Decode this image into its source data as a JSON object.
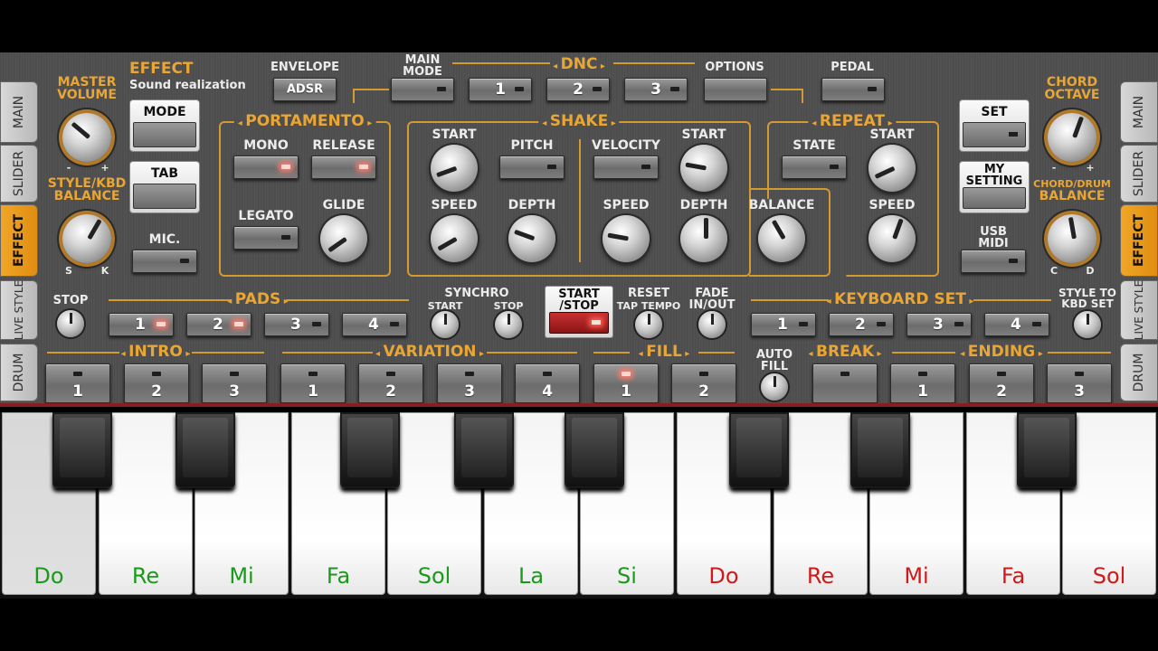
{
  "left_tabs": [
    "MAIN",
    "SLIDER",
    "EFFECT",
    "LIVE STYLE",
    "DRUM"
  ],
  "right_tabs": [
    "MAIN",
    "SLIDER",
    "EFFECT",
    "LIVE STYLE",
    "DRUM"
  ],
  "active_tab": "EFFECT",
  "top": {
    "master_volume": "MASTER\nVOLUME",
    "effect_title": "EFFECT",
    "effect_sub": "Sound realization",
    "envelope": "ENVELOPE",
    "adsr": "ADSR",
    "main_mode": "MAIN\nMODE",
    "dnc": "DNC",
    "dnc_buttons": [
      "1",
      "2",
      "3"
    ],
    "options": "OPTIONS",
    "pedal": "PEDAL",
    "chord_octave": "CHORD\nOCTAVE",
    "plus_minus": [
      "-",
      "+"
    ]
  },
  "left_col": {
    "mode": "MODE",
    "tab": "TAB",
    "style_kbd_balance": "STYLE/KBD\nBALANCE",
    "mic": "MIC.",
    "s": "S",
    "k": "K"
  },
  "portamento": {
    "title": "PORTAMENTO",
    "mono": "MONO",
    "release": "RELEASE",
    "legato": "LEGATO",
    "glide": "GLIDE"
  },
  "shake": {
    "title": "SHAKE",
    "start": "START",
    "pitch": "PITCH",
    "speed": "SPEED",
    "depth": "DEPTH",
    "velocity": "VELOCITY",
    "start2": "START",
    "speed2": "SPEED",
    "depth2": "DEPTH",
    "balance": "BALANCE"
  },
  "repeat": {
    "title": "REPEAT",
    "state": "STATE",
    "start": "START",
    "speed": "SPEED"
  },
  "right_col": {
    "set": "SET",
    "my_setting": "MY\nSETTING",
    "usb_midi": "USB\nMIDI",
    "chord_drum_balance_top": "CHORD/DRUM",
    "chord_drum_balance": "BALANCE",
    "c": "C",
    "d": "D"
  },
  "row3": {
    "stop": "STOP",
    "pads": "PADS",
    "pad_buttons": [
      "1",
      "2",
      "3",
      "4"
    ],
    "synchro": "SYNCHRO",
    "synchro_start": "START",
    "synchro_stop": "STOP",
    "start_stop": "START\n/STOP",
    "reset": "RESET",
    "tap_tempo": "TAP TEMPO",
    "fade": "FADE\nIN/OUT",
    "keyboard_set": "KEYBOARD SET",
    "kbd_buttons": [
      "1",
      "2",
      "3",
      "4"
    ],
    "style_to_kbd": "STYLE TO\nKBD SET"
  },
  "row4": {
    "intro": "INTRO",
    "intro_buttons": [
      "1",
      "2",
      "3"
    ],
    "variation": "VARIATION",
    "variation_buttons": [
      "1",
      "2",
      "3",
      "4"
    ],
    "fill": "FILL",
    "fill_buttons": [
      "1",
      "2"
    ],
    "auto_fill": "AUTO\nFILL",
    "break": "BREAK",
    "ending": "ENDING",
    "ending_buttons": [
      "1",
      "2",
      "3"
    ]
  },
  "keys": [
    {
      "name": "Do",
      "color": "#1a9a1a"
    },
    {
      "name": "Re",
      "color": "#1a9a1a"
    },
    {
      "name": "Mi",
      "color": "#1a9a1a"
    },
    {
      "name": "Fa",
      "color": "#1a9a1a"
    },
    {
      "name": "Sol",
      "color": "#1a9a1a"
    },
    {
      "name": "La",
      "color": "#1a9a1a"
    },
    {
      "name": "Si",
      "color": "#1a9a1a"
    },
    {
      "name": "Do",
      "color": "#d01a1a"
    },
    {
      "name": "Re",
      "color": "#d01a1a"
    },
    {
      "name": "Mi",
      "color": "#d01a1a"
    },
    {
      "name": "Fa",
      "color": "#d01a1a"
    },
    {
      "name": "Sol",
      "color": "#d01a1a"
    }
  ],
  "colors": {
    "accent": "#e9a634",
    "active_tab": "#f0a628",
    "start_stop": "#b02020"
  }
}
